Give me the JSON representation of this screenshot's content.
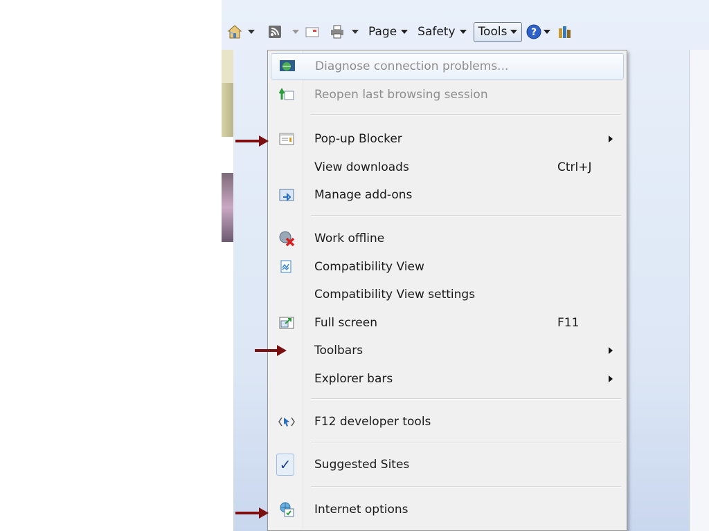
{
  "toolbar": {
    "page_label": "Page",
    "safety_label": "Safety",
    "tools_label": "Tools"
  },
  "menu": {
    "items": [
      {
        "label": "Diagnose connection problems...",
        "icon": "diagnose-icon",
        "disabled": true,
        "highlighted": true
      },
      {
        "label": "Reopen last browsing session",
        "icon": "reopen-icon",
        "disabled": true
      },
      {
        "label": "Pop-up Blocker",
        "icon": "popup-blocker-icon",
        "submenu": true
      },
      {
        "label": "View downloads",
        "shortcut": "Ctrl+J"
      },
      {
        "label": "Manage add-ons",
        "icon": "addons-icon"
      },
      {
        "label": "Work offline",
        "icon": "work-offline-icon"
      },
      {
        "label": "Compatibility View",
        "icon": "compatibility-icon"
      },
      {
        "label": "Compatibility View settings"
      },
      {
        "label": "Full screen",
        "icon": "fullscreen-icon",
        "shortcut": "F11"
      },
      {
        "label": "Toolbars",
        "submenu": true
      },
      {
        "label": "Explorer bars",
        "submenu": true
      },
      {
        "label": "F12 developer tools",
        "icon": "developer-tools-icon"
      },
      {
        "label": "Suggested Sites",
        "checked": true
      },
      {
        "label": "Internet options",
        "icon": "internet-options-icon"
      }
    ]
  },
  "colors": {
    "arrow": "#7a1010",
    "menu_bg": "#f0f0f0",
    "highlight_border": "#b5cfe8"
  }
}
